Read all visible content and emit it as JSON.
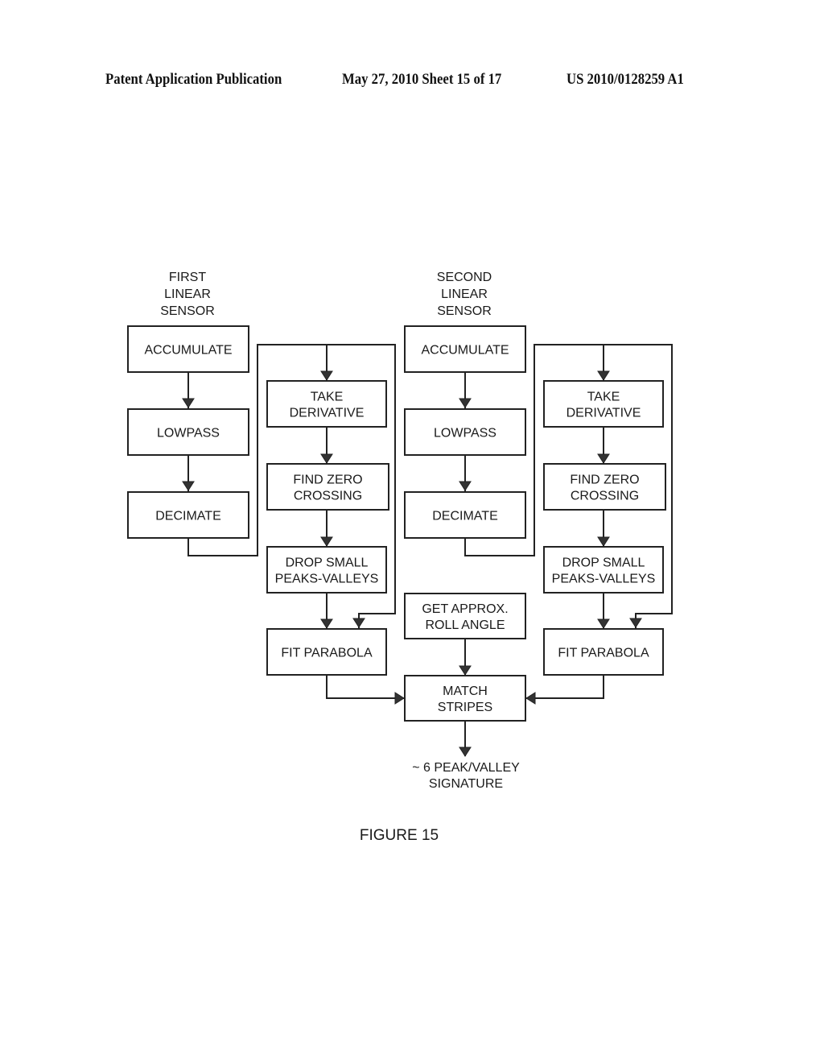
{
  "header": {
    "publication": "Patent Application Publication",
    "date_sheet": "May 27, 2010  Sheet 15 of 17",
    "patent_number": "US 2010/0128259 A1"
  },
  "diagram": {
    "left_sensor_title": [
      "FIRST",
      "LINEAR",
      "SENSOR"
    ],
    "right_sensor_title": [
      "SECOND",
      "LINEAR",
      "SENSOR"
    ],
    "left": {
      "accumulate": [
        "ACCUMULATE"
      ],
      "lowpass": [
        "LOWPASS"
      ],
      "decimate": [
        "DECIMATE"
      ],
      "take_derivative": [
        "TAKE",
        "DERIVATIVE"
      ],
      "find_zero_crossing": [
        "FIND ZERO",
        "CROSSING"
      ],
      "drop_small": [
        "DROP SMALL",
        "PEAKS-VALLEYS"
      ],
      "fit_parabola": [
        "FIT PARABOLA"
      ]
    },
    "right": {
      "accumulate": [
        "ACCUMULATE"
      ],
      "lowpass": [
        "LOWPASS"
      ],
      "decimate": [
        "DECIMATE"
      ],
      "take_derivative": [
        "TAKE",
        "DERIVATIVE"
      ],
      "find_zero_crossing": [
        "FIND ZERO",
        "CROSSING"
      ],
      "drop_small": [
        "DROP SMALL",
        "PEAKS-VALLEYS"
      ],
      "fit_parabola": [
        "FIT PARABOLA"
      ]
    },
    "roll_angle": [
      "GET APPROX.",
      "ROLL ANGLE"
    ],
    "match_stripes": [
      "MATCH",
      "STRIPES"
    ],
    "output": [
      "~ 6 PEAK/VALLEY",
      "SIGNATURE"
    ],
    "figure_caption": "FIGURE 15"
  }
}
